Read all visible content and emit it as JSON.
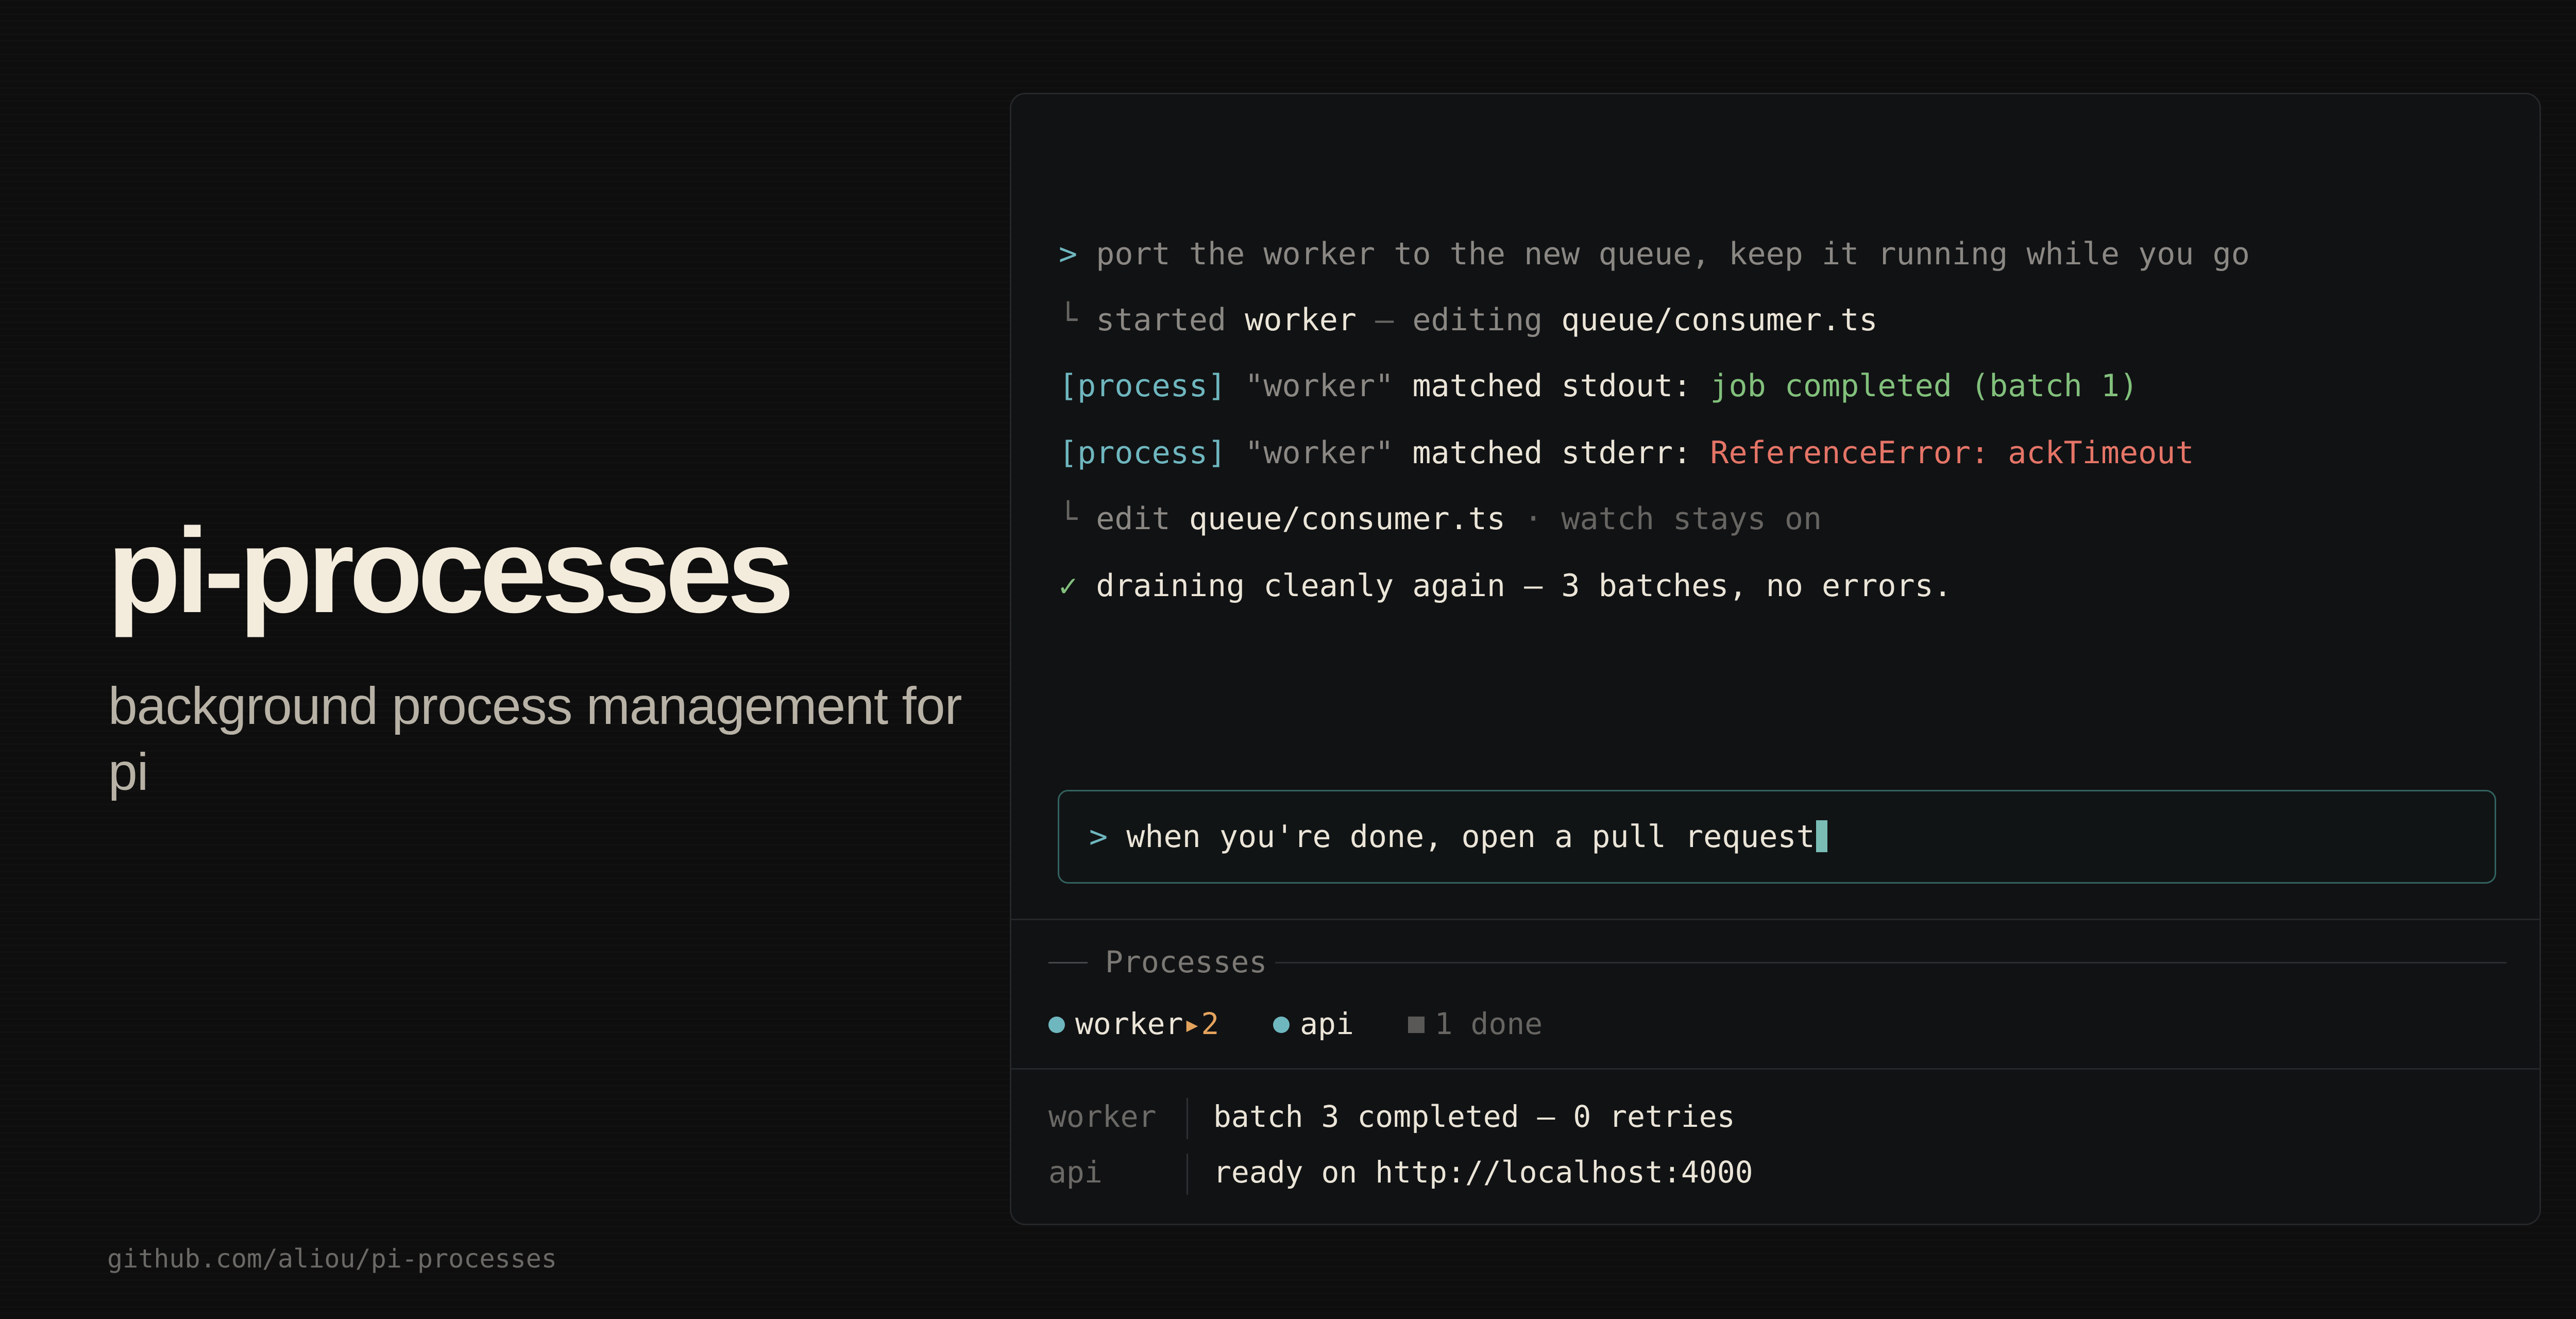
{
  "hero": {
    "title": "pi-processes",
    "subtitle": "background process management for pi",
    "repo": "github.com/aliou/pi-processes"
  },
  "transcript": {
    "user_prompt_marker": ">",
    "user_prompt": "port the worker to the new queue, keep it running while you go",
    "step1": {
      "marker": "└",
      "verb": "started",
      "name": "worker",
      "dash": "—",
      "action": "editing",
      "file": "queue/consumer.ts"
    },
    "event1": {
      "tag": "[process]",
      "name": "\"worker\"",
      "text": "matched stdout:",
      "message": "job completed (batch 1)"
    },
    "event2": {
      "tag": "[process]",
      "name": "\"worker\"",
      "text": "matched stderr:",
      "message": "ReferenceError: ackTimeout"
    },
    "step2": {
      "marker": "└",
      "verb": "edit",
      "file": "queue/consumer.ts",
      "sep": "·",
      "note": "watch stays on"
    },
    "result": {
      "marker": "✓",
      "text": "draining cleanly again — 3 batches, no errors."
    }
  },
  "input": {
    "marker": ">",
    "value": "when you're done, open a pull request"
  },
  "processes": {
    "label": "Processes",
    "items": [
      {
        "name": "worker",
        "badge": "▸2",
        "status": "running"
      },
      {
        "name": "api",
        "status": "running"
      },
      {
        "name": "1 done",
        "status": "done"
      }
    ]
  },
  "logs": [
    {
      "name": "worker",
      "message": "batch 3 completed — 0 retries"
    },
    {
      "name": "api",
      "message": "ready on http://localhost:4000"
    }
  ],
  "colors": {
    "background": "#0e0e0e",
    "title": "#f3ebdc",
    "accent_teal": "#6fb7bf",
    "success_green": "#82c07c",
    "error_red": "#e57567",
    "badge_orange": "#e4a35d"
  }
}
